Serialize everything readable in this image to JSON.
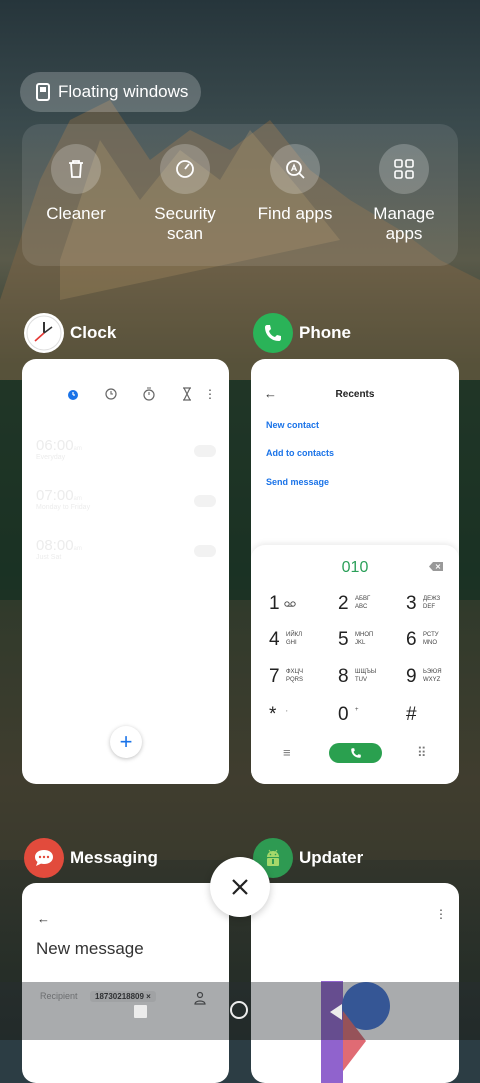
{
  "floating_windows": {
    "label": "Floating windows",
    "icon": "floating-window-icon"
  },
  "quick_actions": [
    {
      "label": "Cleaner",
      "icon": "trash-icon"
    },
    {
      "label": "Security\nscan",
      "icon": "security-scan-icon"
    },
    {
      "label": "Find apps",
      "icon": "find-apps-icon"
    },
    {
      "label": "Manage\napps",
      "icon": "grid-icon"
    }
  ],
  "apps": {
    "clock": {
      "name": "Clock",
      "icon": "clock-icon",
      "alarms": [
        {
          "time": "06:00",
          "ampm": "am",
          "days": "Everyday"
        },
        {
          "time": "07:00",
          "ampm": "am",
          "days": "Monday to Friday"
        },
        {
          "time": "08:00",
          "ampm": "am",
          "days": "Just Sat"
        }
      ],
      "fab_label": "+"
    },
    "phone": {
      "name": "Phone",
      "icon": "phone-icon",
      "back": "←",
      "title": "Recents",
      "links": [
        "New contact",
        "Add to contacts",
        "Send message"
      ],
      "dialed": "010",
      "keys": [
        {
          "digit": "1",
          "letters": ""
        },
        {
          "digit": "2",
          "letters": "АБВГ\nABC"
        },
        {
          "digit": "3",
          "letters": "ДЕЖЗ\nDEF"
        },
        {
          "digit": "4",
          "letters": "ИЙКЛ\nGHI"
        },
        {
          "digit": "5",
          "letters": "МНОП\nJKL"
        },
        {
          "digit": "6",
          "letters": "РСТУ\nMNO"
        },
        {
          "digit": "7",
          "letters": "ФХЦЧ\nPQRS"
        },
        {
          "digit": "8",
          "letters": "ШЩЪЫ\nTUV"
        },
        {
          "digit": "9",
          "letters": "ЬЭЮЯ\nWXYZ"
        },
        {
          "digit": "*",
          "letters": ","
        },
        {
          "digit": "0",
          "letters": "+"
        },
        {
          "digit": "#",
          "letters": ""
        }
      ],
      "menu_icon": "≡",
      "grid_icon": "⠿"
    },
    "messaging": {
      "name": "Messaging",
      "icon": "messaging-icon",
      "back": "←",
      "title": "New message",
      "recipient_label": "Recipient",
      "recipient_number": "18730218809 ×"
    },
    "updater": {
      "name": "Updater",
      "icon": "android-icon",
      "menu": "⋮"
    }
  },
  "close_icon": "close-icon",
  "nav": {
    "recent": "recent-apps-icon",
    "home": "home-icon",
    "back": "back-icon"
  }
}
